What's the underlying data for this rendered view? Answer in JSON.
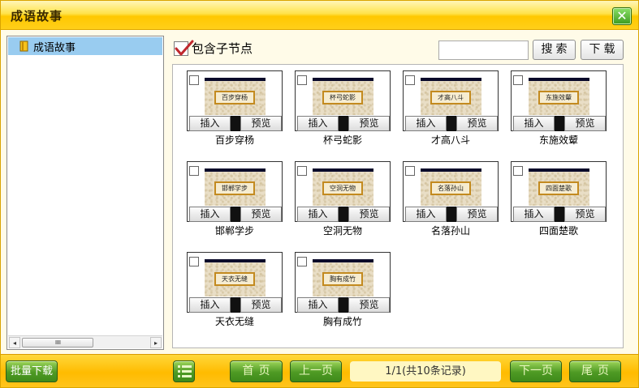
{
  "window": {
    "title": "成语故事",
    "close_label": "✕"
  },
  "tree": {
    "items": [
      {
        "label": "成语故事"
      }
    ],
    "scroll_left": "◂",
    "scroll_right": "▸",
    "scroll_thumb": "IIIIII"
  },
  "toolbar": {
    "include_children_label": "包含子节点",
    "include_children_checked": true,
    "search_value": "",
    "search_label": "搜索",
    "download_label": "下载"
  },
  "cards": [
    {
      "title": "百步穿杨",
      "thumb_text": "百步穿杨"
    },
    {
      "title": "杯弓蛇影",
      "thumb_text": "杯弓蛇影"
    },
    {
      "title": "才高八斗",
      "thumb_text": "才高八斗"
    },
    {
      "title": "东施效颦",
      "thumb_text": "东施效颦"
    },
    {
      "title": "邯郸学步",
      "thumb_text": "邯郸学步"
    },
    {
      "title": "空洞无物",
      "thumb_text": "空洞无物"
    },
    {
      "title": "名落孙山",
      "thumb_text": "名落孙山"
    },
    {
      "title": "四面楚歌",
      "thumb_text": "四面楚歌"
    },
    {
      "title": "天衣无缝",
      "thumb_text": "天衣无缝"
    },
    {
      "title": "胸有成竹",
      "thumb_text": "胸有成竹"
    }
  ],
  "card_buttons": {
    "insert_label": "插入",
    "preview_label": "预览"
  },
  "pager": {
    "batch_download_label": "批量下载",
    "first_label": "首页",
    "prev_label": "上一页",
    "info": "1/1(共10条记录)",
    "next_label": "下一页",
    "last_label": "尾页"
  },
  "colors": {
    "title_bar": "#ffd21a",
    "tree_selection": "#99ccf0",
    "green_button": "#4e9a24",
    "close_button": "#3c9a1e"
  },
  "icons": {
    "close": "close-icon",
    "folder": "folder-icon",
    "check": "checkmark-icon",
    "list": "list-icon"
  }
}
